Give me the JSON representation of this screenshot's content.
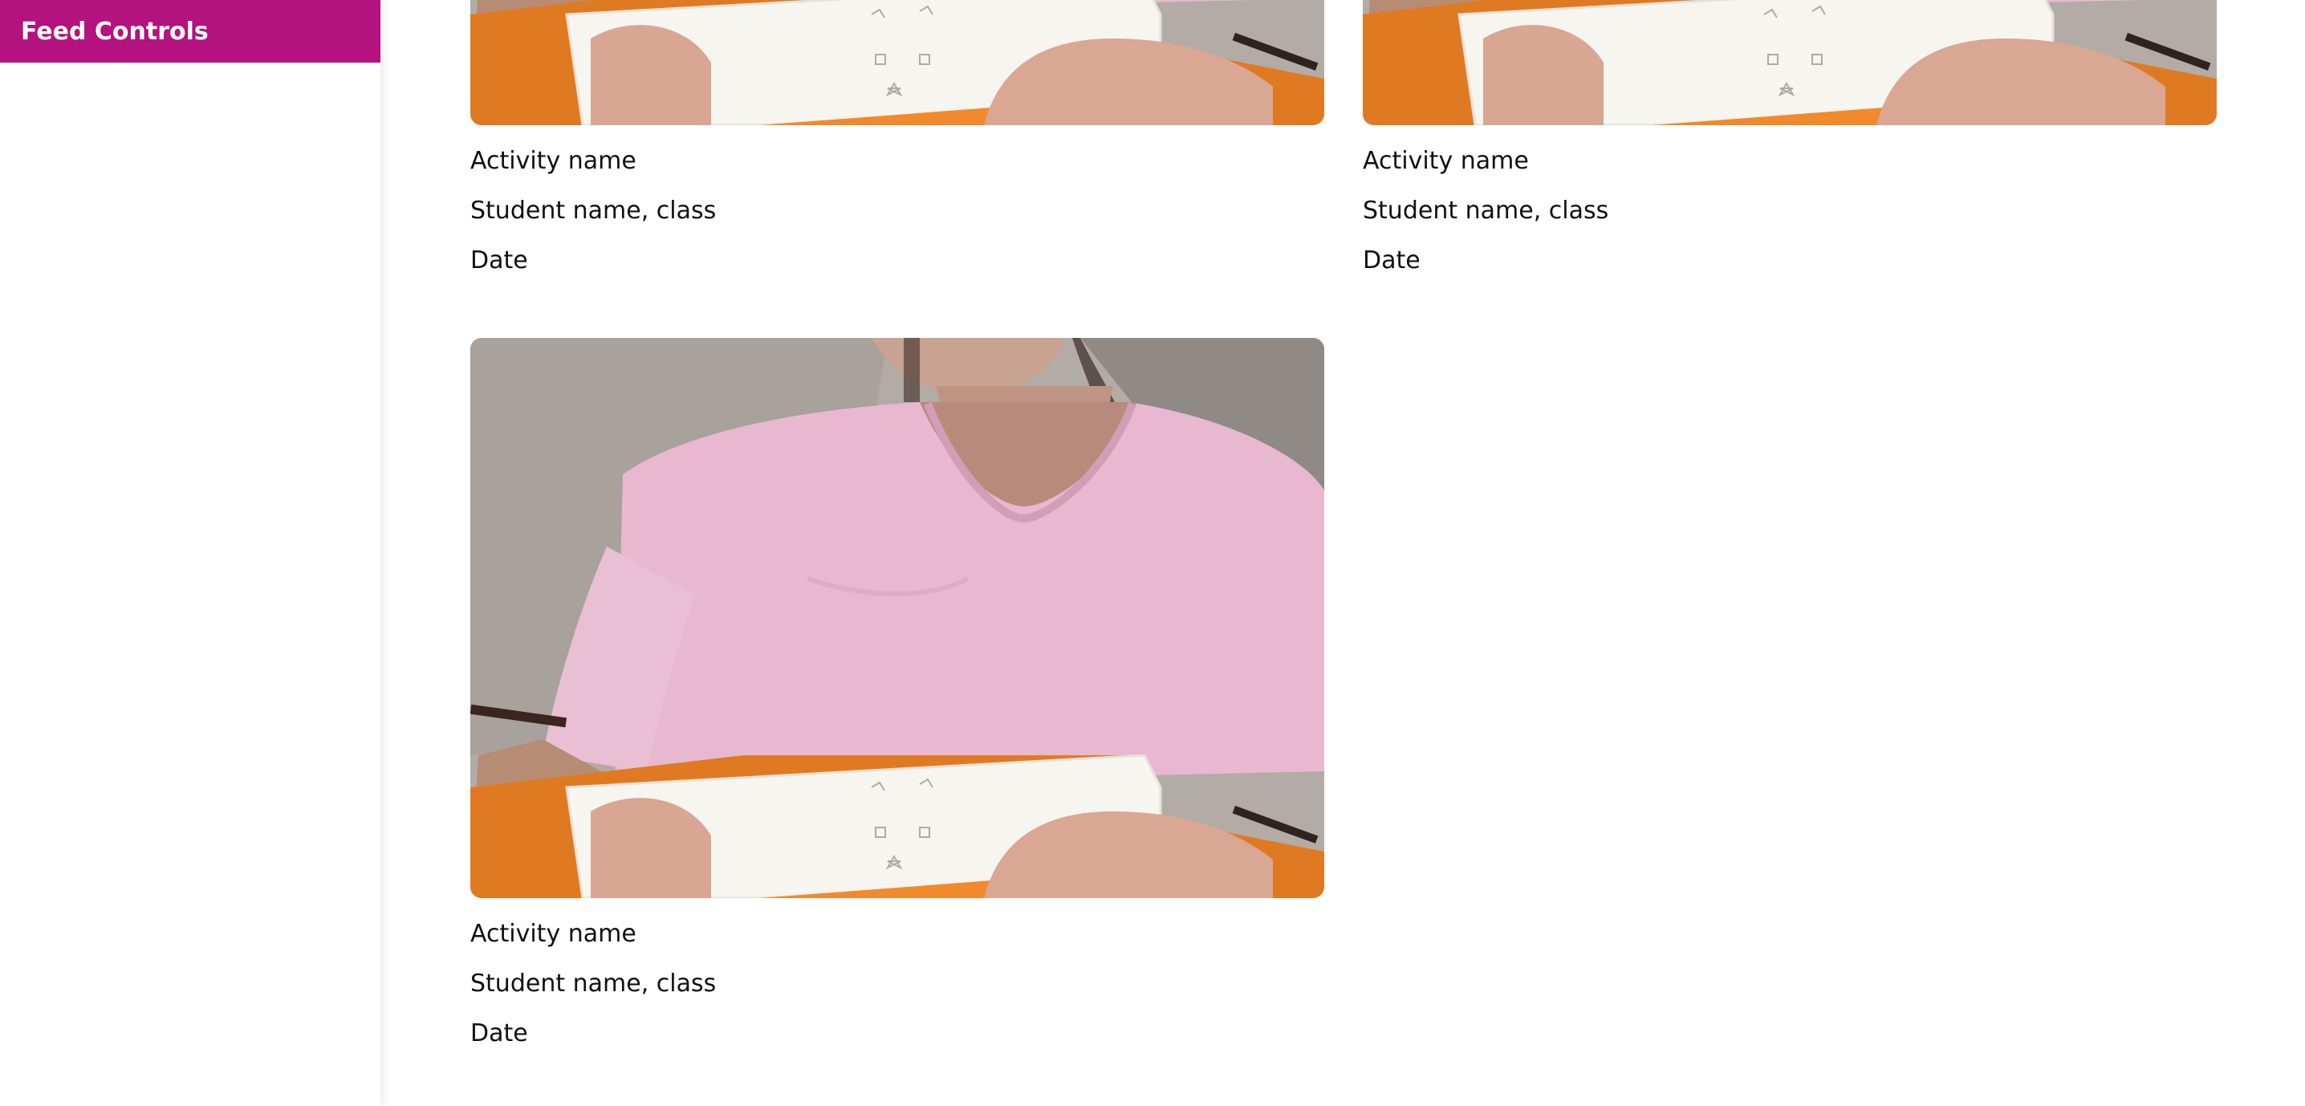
{
  "sidebar": {
    "title": "Feed Controls",
    "accent_color": "#b3127f"
  },
  "feed": {
    "cards": [
      {
        "activity": "Activity name",
        "student": "Student name, class",
        "date": "Date",
        "image_icon": "student-activity-photo"
      },
      {
        "activity": "Activity name",
        "student": "Student name, class",
        "date": "Date",
        "image_icon": "student-activity-photo"
      },
      {
        "activity": "Activity name",
        "student": "Student name, class",
        "date": "Date",
        "image_icon": "student-activity-photo"
      }
    ]
  }
}
